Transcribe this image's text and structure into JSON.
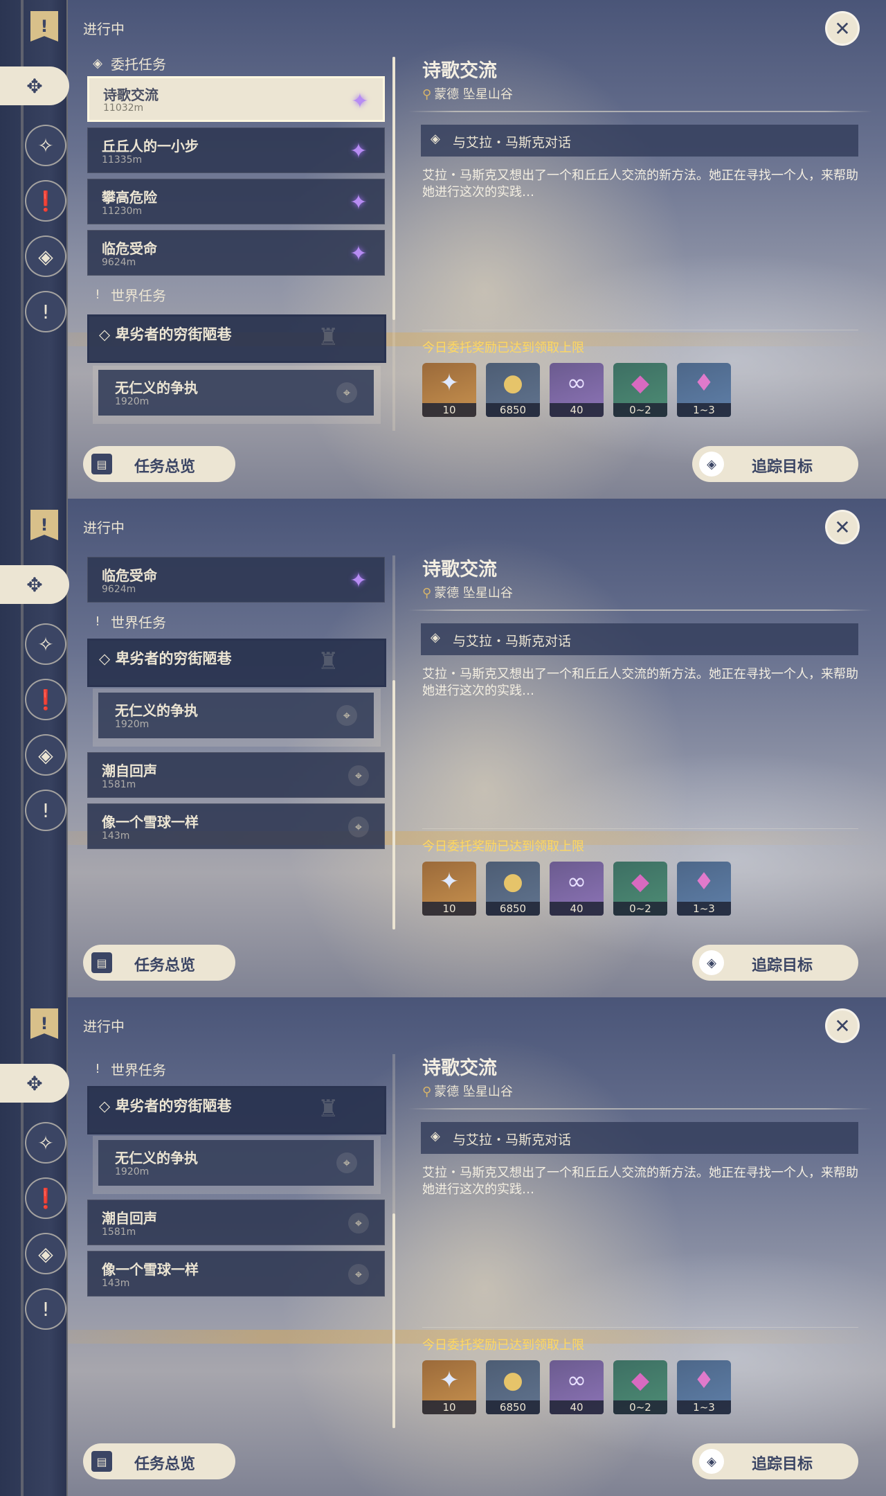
{
  "frames": [
    {
      "status": "进行中",
      "categories": {
        "commission": "委托任务",
        "world": "世界任务"
      },
      "quests": [
        {
          "name": "诗歌交流",
          "distance": "11032m"
        },
        {
          "name": "丘丘人的一小步",
          "distance": "11335m"
        },
        {
          "name": "攀高危险",
          "distance": "11230m"
        },
        {
          "name": "临危受命",
          "distance": "9624m"
        }
      ],
      "world_group": {
        "name": "卑劣者的穷街陋巷",
        "sub_name": "无仁义的争执",
        "sub_distance": "1920m"
      },
      "world_quests": []
    },
    {
      "status": "进行中",
      "categories": {
        "commission": "委托任务",
        "world": "世界任务"
      },
      "quests": [
        {
          "name": "临危受命",
          "distance": "9624m"
        }
      ],
      "world_group": {
        "name": "卑劣者的穷街陋巷",
        "sub_name": "无仁义的争执",
        "sub_distance": "1920m"
      },
      "world_quests": [
        {
          "name": "潮自回声",
          "distance": "1581m"
        },
        {
          "name": "像一个雪球一样",
          "distance": "143m"
        }
      ]
    },
    {
      "status": "进行中",
      "categories": {
        "commission": "委托任务",
        "world": "世界任务"
      },
      "quests": [],
      "world_group": {
        "name": "卑劣者的穷街陋巷",
        "sub_name": "无仁义的争执",
        "sub_distance": "1920m"
      },
      "world_quests": [
        {
          "name": "潮自回声",
          "distance": "1581m"
        },
        {
          "name": "像一个雪球一样",
          "distance": "143m"
        }
      ]
    }
  ],
  "detail": {
    "title": "诗歌交流",
    "location": "蒙德 坠星山谷",
    "objective": "与艾拉・马斯克对话",
    "description": "艾拉・马斯克又想出了一个和丘丘人交流的新方法。她正在寻找一个人，来帮助她进行这次的实践…",
    "reward_limit_note": "今日委托奖励已达到领取上限",
    "rewards": [
      {
        "icon": "primogem-icon",
        "amount": "10"
      },
      {
        "icon": "mora-icon",
        "amount": "6850"
      },
      {
        "icon": "friendship-icon",
        "amount": "40"
      },
      {
        "icon": "crystal-icon",
        "amount": "0~2"
      },
      {
        "icon": "crystal-cluster-icon",
        "amount": "1~3"
      }
    ]
  },
  "buttons": {
    "overview": "任务总览",
    "track": "追踪目标"
  },
  "colors": {
    "accent": "#ece5d3",
    "reward_note": "#ffd860",
    "commission_star": "#b78cf3"
  }
}
